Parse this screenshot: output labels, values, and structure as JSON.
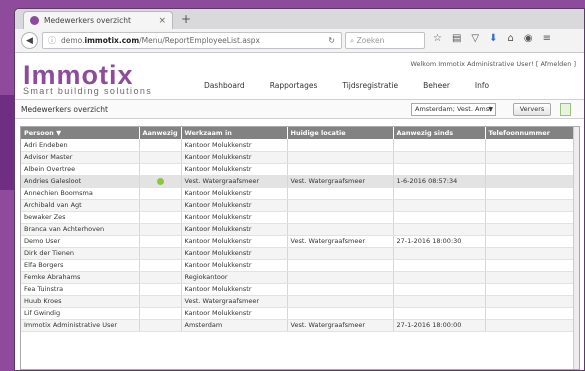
{
  "browser": {
    "tab_title": "Medewerkers overzicht",
    "tab_close": "×",
    "new_tab": "+",
    "url_prefix": "demo.",
    "url_host": "immotix.com",
    "url_path": "/Menu/ReportEmployeeList.aspx",
    "search_placeholder": "Zoeken"
  },
  "app": {
    "logo": "Immotix",
    "tagline": "Smart building solutions",
    "welcome": "Welkom Immotix Administrative User! [ Afmelden ]",
    "nav": [
      "Dashboard",
      "Rapportages",
      "Tijdsregistratie",
      "Beheer",
      "Info"
    ],
    "page_title": "Medewerkers overzicht",
    "location_value": "Amsterdam; Vest. Amst",
    "refresh_label": "Ververs"
  },
  "grid": {
    "columns": [
      "Persoon ▼",
      "Aanwezig",
      "Werkzaam in",
      "Huidige locatie",
      "Aanwezig sinds",
      "Telefoonnummer"
    ],
    "rows": [
      {
        "person": "Adri Endeben",
        "present": false,
        "location": "Kantoor Molukkenstr",
        "current": "",
        "since": "",
        "phone": ""
      },
      {
        "person": "Advisor Master",
        "present": false,
        "location": "Kantoor Molukkenstr",
        "current": "",
        "since": "",
        "phone": ""
      },
      {
        "person": "Albein Overtree",
        "present": false,
        "location": "Kantoor Molukkenstr",
        "current": "",
        "since": "",
        "phone": ""
      },
      {
        "person": "Andries Galesloot",
        "present": true,
        "location": "Vest. Watergraafsmeer",
        "current": "Vest. Watergraafsmeer",
        "since": "1-6-2016 08:57:34",
        "phone": ""
      },
      {
        "person": "Annechien Boomsma",
        "present": false,
        "location": "Kantoor Molukkenstr",
        "current": "",
        "since": "",
        "phone": ""
      },
      {
        "person": "Archibald van Agt",
        "present": false,
        "location": "Kantoor Molukkenstr",
        "current": "",
        "since": "",
        "phone": ""
      },
      {
        "person": "bewaker Zes",
        "present": false,
        "location": "Kantoor Molukkenstr",
        "current": "",
        "since": "",
        "phone": ""
      },
      {
        "person": "Branca van Achterhoven",
        "present": false,
        "location": "Kantoor Molukkenstr",
        "current": "",
        "since": "",
        "phone": ""
      },
      {
        "person": "Demo User",
        "present": false,
        "location": "Kantoor Molukkenstr",
        "current": "Vest. Watergraafsmeer",
        "since": "27-1-2016 18:00:30",
        "phone": ""
      },
      {
        "person": "Dirk der Tienen",
        "present": false,
        "location": "Kantoor Molukkenstr",
        "current": "",
        "since": "",
        "phone": ""
      },
      {
        "person": "Elfa Borgers",
        "present": false,
        "location": "Kantoor Molukkenstr",
        "current": "",
        "since": "",
        "phone": ""
      },
      {
        "person": "Femke Abrahams",
        "present": false,
        "location": "Regiokantoor",
        "current": "",
        "since": "",
        "phone": ""
      },
      {
        "person": "Fea Tuinstra",
        "present": false,
        "location": "Kantoor Molukkenstr",
        "current": "",
        "since": "",
        "phone": ""
      },
      {
        "person": "Huub Kroes",
        "present": false,
        "location": "Vest. Watergraafsmeer",
        "current": "",
        "since": "",
        "phone": ""
      },
      {
        "person": "Lif Gwindig",
        "present": false,
        "location": "Kantoor Molukkenstr",
        "current": "",
        "since": "",
        "phone": ""
      },
      {
        "person": "Immotix Administrative User",
        "present": false,
        "location": "Amsterdam",
        "current": "Vest. Watergraafsmeer",
        "since": "27-1-2016 18:00:00",
        "phone": ""
      }
    ]
  },
  "colors": {
    "brand": "#8e4b9c",
    "present_dot": "#8cc63f",
    "header_bg": "#828282"
  }
}
